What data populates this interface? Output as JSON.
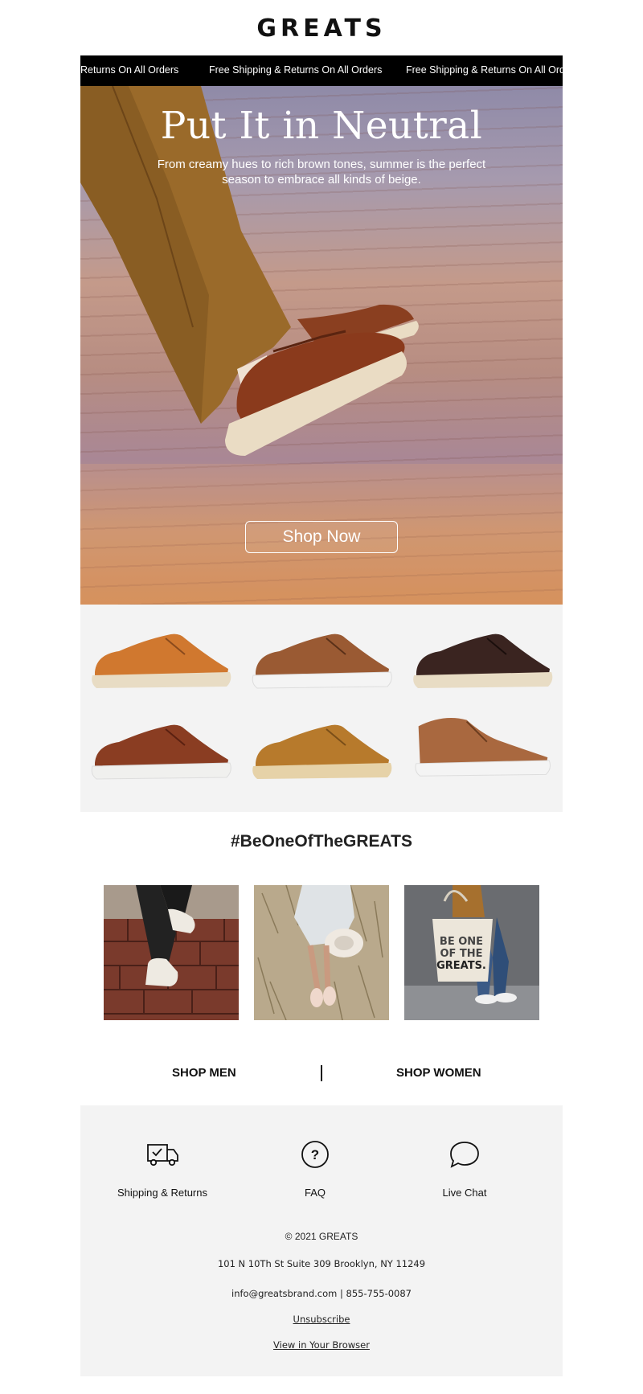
{
  "brand": {
    "logo": "GREATS"
  },
  "marquee": {
    "items": [
      "Returns On All Orders",
      "Free Shipping & Returns On All Orders",
      "Free Shipping & Returns On All Orders"
    ]
  },
  "hero": {
    "title": "Put It in Neutral",
    "subtitle": "From creamy hues to rich brown tones, summer is the perfect season to embrace all kinds of beige.",
    "cta_label": "Shop Now"
  },
  "products": {
    "items": [
      {
        "upper": "#d0782f",
        "sole": "#e8dcc4"
      },
      {
        "upper": "#9a5a33",
        "sole": "#f4f4f4"
      },
      {
        "upper": "#3a2420",
        "sole": "#e8dcc4"
      },
      {
        "upper": "#8a3d22",
        "sole": "#f0f0ee"
      },
      {
        "upper": "#b77a2c",
        "sole": "#e6d2a8"
      },
      {
        "upper": "#a9683f",
        "sole": "#f4f4f4"
      }
    ]
  },
  "community": {
    "hashtag": "#BeOneOfTheGREATS",
    "tote_text": [
      "BE ONE",
      "OF THE",
      "GREATS."
    ]
  },
  "shop_links": {
    "men": "SHOP MEN",
    "women": "SHOP WOMEN"
  },
  "footer": {
    "services": [
      {
        "label": "Shipping & Returns",
        "icon": "truck-icon"
      },
      {
        "label": "FAQ",
        "icon": "question-circle-icon"
      },
      {
        "label": "Live Chat",
        "icon": "chat-bubble-icon"
      }
    ],
    "copyright": "© 2021 GREATS",
    "address": "101 N 10Th St Suite 309 Brooklyn, NY 11249",
    "contact": "info@greatsbrand.com | 855-755-0087",
    "unsubscribe": "Unsubscribe",
    "view_browser": "View in Your Browser"
  }
}
